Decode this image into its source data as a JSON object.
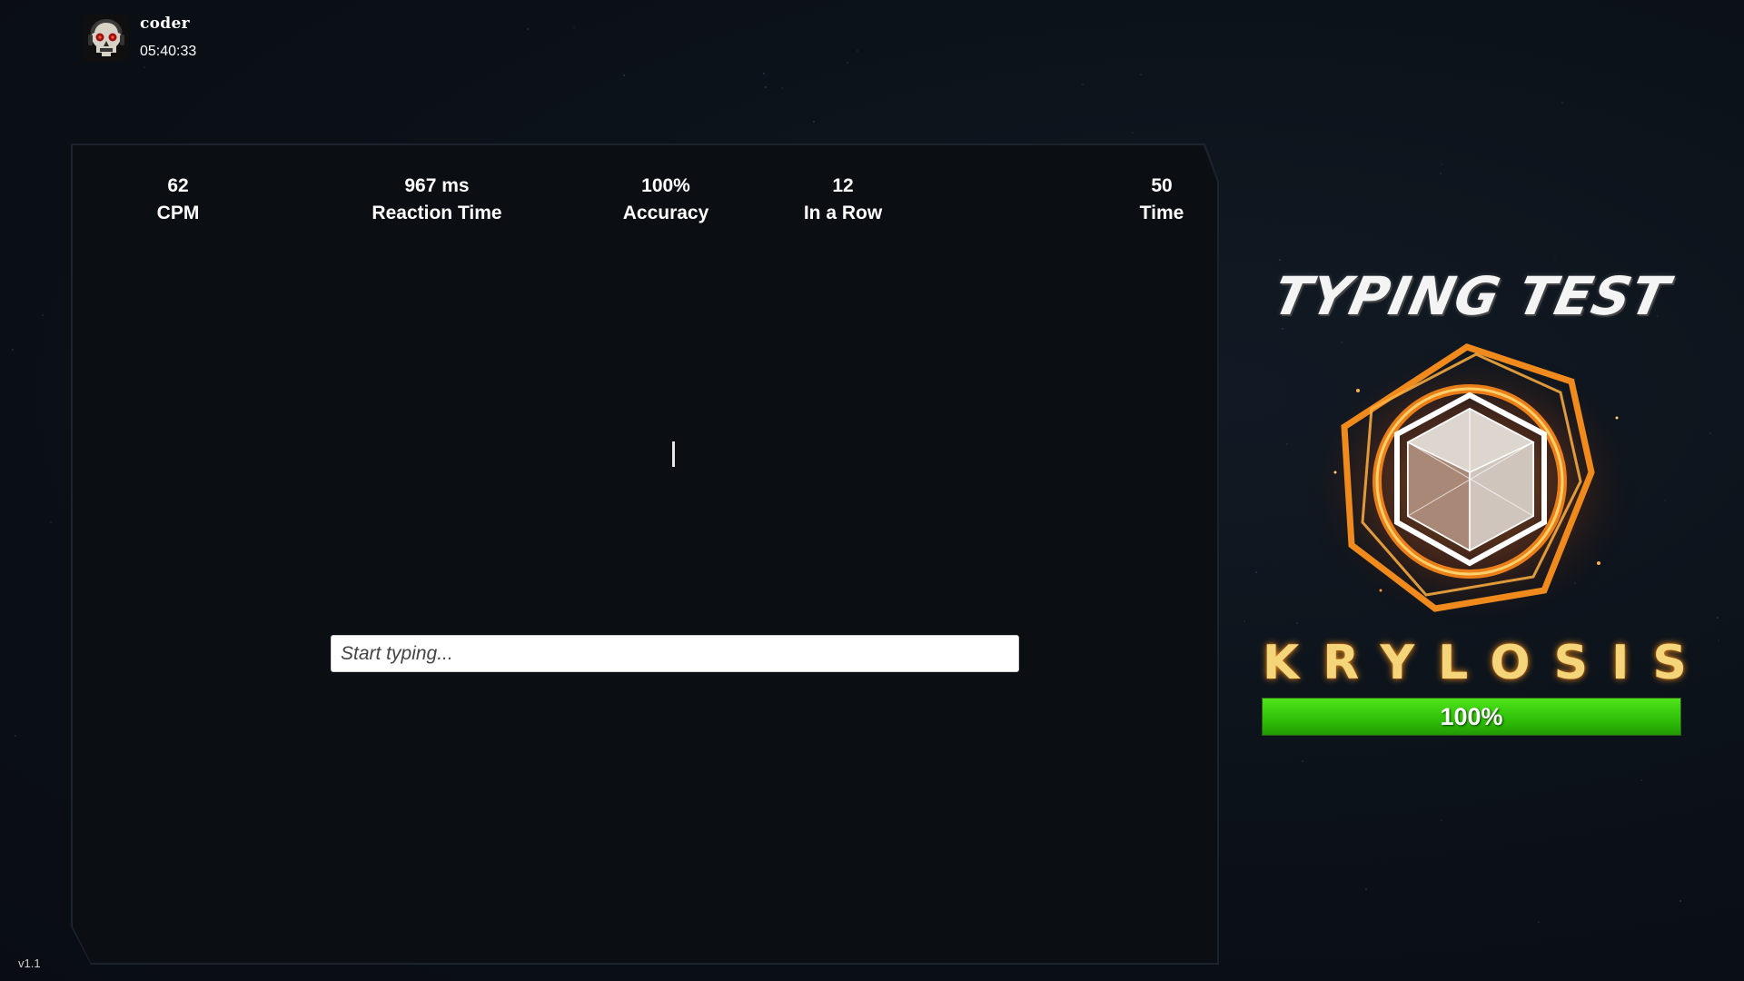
{
  "user": {
    "name": "coder",
    "time": "05:40:33"
  },
  "stats": [
    {
      "value": "62",
      "label": "CPM"
    },
    {
      "value": "967 ms",
      "label": "Reaction Time"
    },
    {
      "value": "100%",
      "label": "Accuracy"
    },
    {
      "value": "12",
      "label": "In a Row"
    },
    {
      "value": "50",
      "label": "Time"
    }
  ],
  "input": {
    "value": "",
    "placeholder": "Start typing..."
  },
  "title": "TYPING TEST",
  "rank": {
    "name": "KRYLOSIS",
    "progress_percent": 100,
    "progress_label": "100%"
  },
  "version": "v1.1",
  "colors": {
    "progress_green": "#3ccf10",
    "rank_gold": "#f5d57a",
    "emblem_orange": "#f08a1c"
  }
}
